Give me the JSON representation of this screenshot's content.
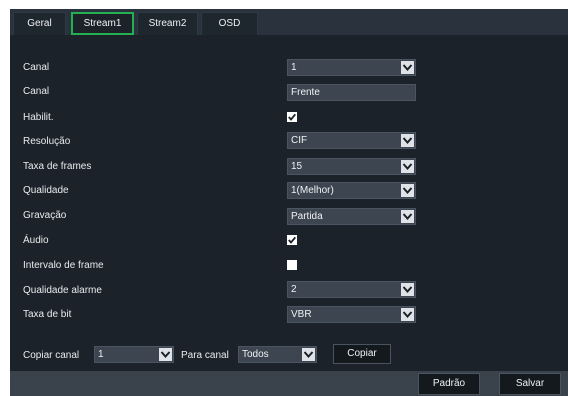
{
  "tabs": [
    {
      "label": "Geral",
      "active": false
    },
    {
      "label": "Stream1",
      "active": true
    },
    {
      "label": "Stream2",
      "active": false
    },
    {
      "label": "OSD",
      "active": false
    }
  ],
  "form": {
    "canal": {
      "label": "Canal",
      "value": "1"
    },
    "canal_name": {
      "label": "Canal",
      "value": "Frente"
    },
    "habilit": {
      "label": "Habilit.",
      "checked": true
    },
    "resolucao": {
      "label": "Resolução",
      "value": "CIF"
    },
    "taxa_frames": {
      "label": "Taxa de frames",
      "value": "15"
    },
    "qualidade": {
      "label": "Qualidade",
      "value": "1(Melhor)"
    },
    "gravacao": {
      "label": "Gravação",
      "value": "Partida"
    },
    "audio": {
      "label": "Áudio",
      "checked": true
    },
    "intervalo": {
      "label": "Intervalo de frame",
      "checked": false
    },
    "qualidade_alarme": {
      "label": "Qualidade alarme",
      "value": "2"
    },
    "taxa_bit": {
      "label": "Taxa de bit",
      "value": "VBR"
    }
  },
  "copy": {
    "label": "Copiar canal",
    "from_value": "1",
    "to_label": "Para canal",
    "to_value": "Todos",
    "button": "Copiar"
  },
  "footer": {
    "default_button": "Padrão",
    "save_button": "Salvar"
  },
  "colors": {
    "panel_bg": "#1b2229",
    "active_tab_border": "#23b050",
    "field_bg": "#3c4550",
    "footer_bg": "#3a424c"
  },
  "icons": {
    "dropdown": "chevron-down-icon",
    "checkbox": "checkmark-icon"
  }
}
